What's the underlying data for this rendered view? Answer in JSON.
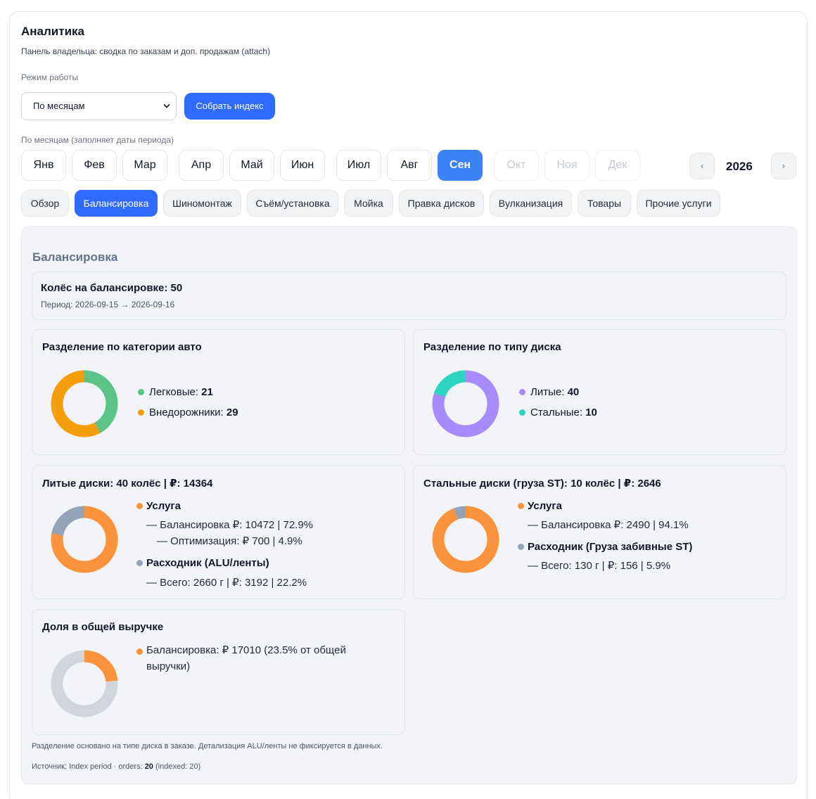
{
  "header": {
    "title": "Аналитика",
    "subtitle": "Панель владельца: сводка по заказам и доп. продажам (attach)"
  },
  "mode": {
    "label": "Режим работы",
    "select_value": "По месяцам",
    "build_button": "Собрать индекс"
  },
  "months": {
    "label": "По месяцам (заполняет даты периода)",
    "items": [
      "Янв",
      "Фев",
      "Мар",
      "Апр",
      "Май",
      "Июн",
      "Июл",
      "Авг",
      "Сен",
      "Окт",
      "Ноя",
      "Дек"
    ],
    "active": "Сен",
    "disabled": [
      "Окт",
      "Ноя",
      "Дек"
    ],
    "year": "2026",
    "prev": "‹",
    "next": "›"
  },
  "tabs": [
    "Обзор",
    "Балансировка",
    "Шиномонтаж",
    "Съём/установка",
    "Мойка",
    "Правка дисков",
    "Вулканизация",
    "Товары",
    "Прочие услуги"
  ],
  "active_tab": "Балансировка",
  "section": {
    "title": "Балансировка",
    "summary_title": "Колёс на балансировке: 50",
    "period": "Период: 2026-09-15 → 2026-09-16",
    "category": {
      "title": "Разделение по категории авто",
      "items": [
        {
          "label": "Легковые: ",
          "value": "21",
          "color": "#5cc386"
        },
        {
          "label": "Внедорожники: ",
          "value": "29",
          "color": "#f59e0b"
        }
      ]
    },
    "disk_type": {
      "title": "Разделение по типу диска",
      "items": [
        {
          "label": "Литые: ",
          "value": "40",
          "color": "#a78bfa"
        },
        {
          "label": "Стальные: ",
          "value": "10",
          "color": "#2dd4bf"
        }
      ]
    },
    "alloy": {
      "title": "Литые диски: 40 колёс | ₽: 14364",
      "service_head": "Услуга",
      "service_line1": "— Балансировка ₽: 10472 | 72.9%",
      "service_line2": "— Оптимизация: ₽ 700 | 4.9%",
      "consumable_head": "Расходник (ALU/ленты)",
      "consumable_line": "— Всего: 2660 г | ₽: 3192 | 22.2%",
      "service_color": "#fb923c",
      "consumable_color": "#94a3b8",
      "service_share": 77.8
    },
    "steel": {
      "title": "Стальные диски (груза ST): 10 колёс | ₽: 2646",
      "service_head": "Услуга",
      "service_line1": "— Балансировка ₽: 2490 | 94.1%",
      "consumable_head": "Расходник (Груза забивные ST)",
      "consumable_line": "— Всего: 130 г | ₽: 156 | 5.9%",
      "service_color": "#fb923c",
      "consumable_color": "#94a3b8",
      "service_share": 94.1
    },
    "revenue": {
      "title": "Доля в общей выручке",
      "line": "Балансировка: ₽ 17010 (23.5% от общей выручки)",
      "color": "#fb923c",
      "rest_color": "#d1d5db",
      "share": 23.5
    },
    "note": "Разделение основано на типе диска в заказе. Детализация ALU/ленты не фиксируется в данных.",
    "source_prefix": "Источник: Index period · orders: ",
    "source_orders": "20",
    "source_suffix": " (indexed: 20)"
  }
}
